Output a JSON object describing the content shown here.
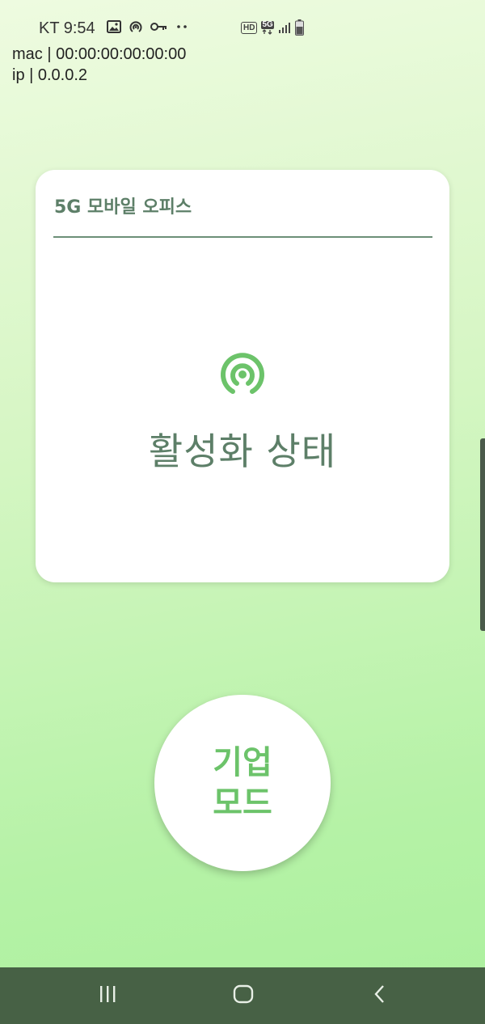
{
  "status_bar": {
    "carrier_time": "KT 9:54",
    "left_icons": [
      "image-icon",
      "hotspot-icon",
      "key-icon",
      "more-dots-icon"
    ],
    "right_icons": [
      "hd-voice-icon",
      "5g-data-icon",
      "signal-icon",
      "battery-icon"
    ],
    "hd_label": "HD",
    "fiveg_label": "5G"
  },
  "info": {
    "mac": "mac | 00:00:00:00:00:00",
    "ip": "ip | 0.0.0.2"
  },
  "card": {
    "title": "5G 모바일 오피스",
    "status_icon": "hotspot-icon",
    "status_text": "활성화 상태"
  },
  "mode_button": {
    "line1": "기업",
    "line2": "모드"
  },
  "nav_bar": {
    "buttons": [
      "recents-icon",
      "home-icon",
      "back-icon"
    ]
  },
  "colors": {
    "accent_green": "#6cc36a",
    "text_green": "#5d7f68",
    "nav_bar": "#476145",
    "background_top": "#eefbe0",
    "background_bottom": "#abf09e"
  }
}
